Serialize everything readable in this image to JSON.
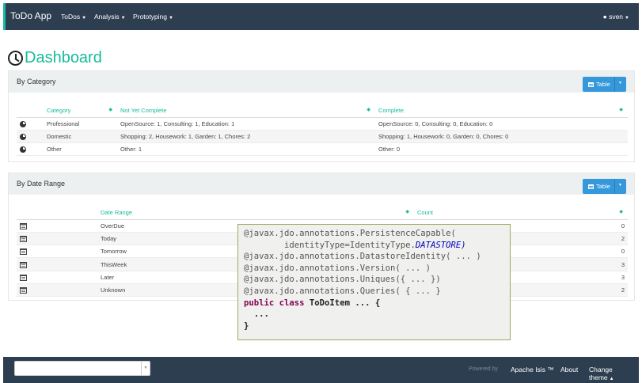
{
  "navbar": {
    "brand": "ToDo App",
    "menus": [
      "ToDos",
      "Analysis",
      "Prototyping"
    ],
    "user": "sven"
  },
  "page": {
    "title": "Dashboard"
  },
  "by_category": {
    "title": "By Category",
    "button": "Table",
    "columns": [
      "Category",
      "Not Yet Complete",
      "Complete"
    ],
    "rows": [
      [
        "Professional",
        "OpenSource: 1, Consulting: 1, Education: 1",
        "OpenSource: 0, Consulting: 0, Education: 0"
      ],
      [
        "Domestic",
        "Shopping: 2, Housework: 1, Garden: 1, Chores: 2",
        "Shopping: 1, Housework: 0, Garden: 0, Chores: 0"
      ],
      [
        "Other",
        "Other: 1",
        "Other: 0"
      ]
    ]
  },
  "by_date_range": {
    "title": "By Date Range",
    "button": "Table",
    "columns": [
      "Date Range",
      "Count"
    ],
    "rows": [
      [
        "OverDue",
        "0"
      ],
      [
        "Today",
        "2"
      ],
      [
        "Tomorrow",
        "0"
      ],
      [
        "ThisWeek",
        "3"
      ],
      [
        "Later",
        "3"
      ],
      [
        "Unknown",
        "2"
      ]
    ]
  },
  "code": {
    "l1": "@javax.jdo.annotations.PersistenceCapable(",
    "l2a": "        identityType=IdentityType.",
    "l2b": "DATASTORE)",
    "l3": "@javax.jdo.annotations.DatastoreIdentity( ... )",
    "l4": "@javax.jdo.annotations.Version( ... )",
    "l5": "@javax.jdo.annotations.Uniques({ ... })",
    "l6": "@javax.jdo.annotations.Queries( { ... }",
    "l7a": "public class ",
    "l7b": "ToDoItem ... {",
    "l8": "  ...",
    "l9": "}"
  },
  "footer": {
    "powered_by": "Powered by",
    "links": [
      "Apache Isis ™",
      "About",
      "Change theme"
    ]
  }
}
